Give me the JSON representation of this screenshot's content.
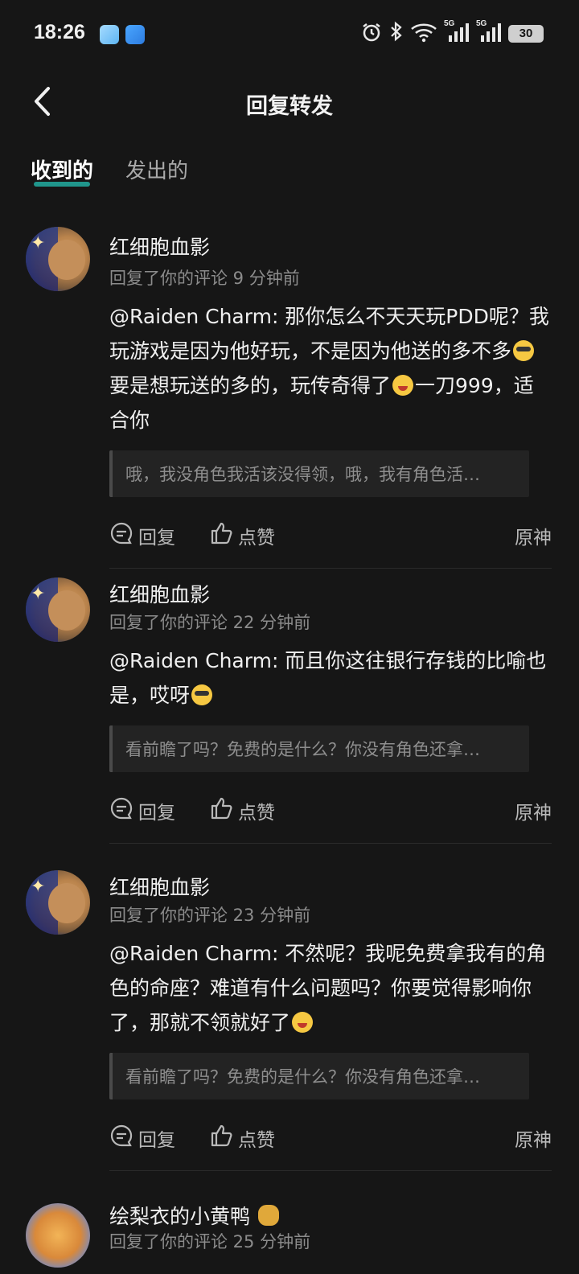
{
  "status": {
    "time": "18:26",
    "battery": "30",
    "signal1": "5G",
    "signal2": "5G"
  },
  "header": {
    "title": "回复转发"
  },
  "tabs": [
    {
      "label": "收到的"
    },
    {
      "label": "发出的"
    }
  ],
  "comments": [
    {
      "user": "红细胞血影",
      "meta": "回复了你的评论 9 分钟前",
      "text_parts": [
        "@Raiden Charm: 那你怎么不天天玩PDD呢？我玩游戏是因为他好玩，不是因为他送的多不多",
        "要是想玩送的多的，玩传奇得了",
        "一刀999，适合你"
      ],
      "quote": "哦，我没角色我活该没得领，哦，我有角色活…",
      "reply": "回复",
      "like": "点赞",
      "source": "原神"
    },
    {
      "user": "红细胞血影",
      "meta": "回复了你的评论 22 分钟前",
      "text_parts": [
        "@Raiden Charm: 而且你这往银行存钱的比喻也是，哎呀"
      ],
      "quote": "看前瞻了吗？免费的是什么？你没有角色还拿…",
      "reply": "回复",
      "like": "点赞",
      "source": "原神"
    },
    {
      "user": "红细胞血影",
      "meta": "回复了你的评论 23 分钟前",
      "text_parts": [
        "@Raiden Charm: 不然呢？我呢免费拿我有的角色的命座？难道有什么问题吗？你要觉得影响你了，那就不领就好了"
      ],
      "quote": "看前瞻了吗？免费的是什么？你没有角色还拿…",
      "reply": "回复",
      "like": "点赞",
      "source": "原神"
    },
    {
      "user": "绘梨衣的小黄鸭",
      "meta": "回复了你的评论 25 分钟前"
    }
  ],
  "icons": [
    "back-arrow-icon",
    "alarm-icon",
    "bluetooth-icon",
    "wifi-icon",
    "signal-icon",
    "battery-icon",
    "comment-icon",
    "thumb-up-icon",
    "emoji-cool-icon",
    "emoji-grin-icon"
  ],
  "colors": {
    "background": "#161616",
    "accent": "#24c1b4",
    "text": "#efefef",
    "muted": "#8c8c8c"
  }
}
